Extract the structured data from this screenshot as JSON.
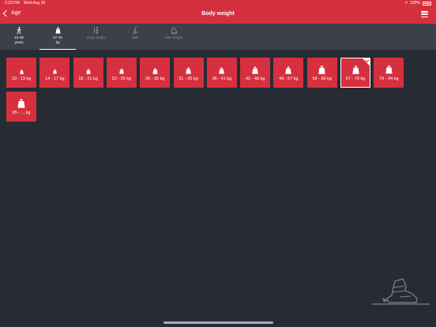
{
  "status": {
    "time": "2:23 PM",
    "date": "Wed Aug 26",
    "battery": "100%"
  },
  "nav": {
    "back_label": "Age",
    "title": "Body weight"
  },
  "tabs": [
    {
      "label": "10-49\nyears",
      "icon": "walking-person-icon",
      "active": false,
      "dim": false
    },
    {
      "label": "67-78\nkg",
      "icon": "weight-icon",
      "active": true,
      "dim": false
    },
    {
      "label": "Body height",
      "icon": "body-height-icon",
      "active": false,
      "dim": true
    },
    {
      "label": "Skill",
      "icon": "skier-icon",
      "active": false,
      "dim": true
    },
    {
      "label": "Sole length",
      "icon": "sole-length-icon",
      "active": false,
      "dim": true
    }
  ],
  "weights": [
    {
      "label": "10 - 13 kg"
    },
    {
      "label": "14 - 17 kg"
    },
    {
      "label": "18 - 21 kg"
    },
    {
      "label": "22 - 25 kg"
    },
    {
      "label": "26 - 30 kg"
    },
    {
      "label": "31 - 35 kg"
    },
    {
      "label": "36 - 41 kg"
    },
    {
      "label": "42 - 48 kg"
    },
    {
      "label": "49 - 57 kg"
    },
    {
      "label": "58 - 66 kg"
    },
    {
      "label": "67 - 78 kg",
      "selected": true
    },
    {
      "label": "79 - 94 kg"
    },
    {
      "label": "95 - ... kg"
    }
  ],
  "colors": {
    "accent": "#d6303f",
    "background": "#272b34",
    "tabbar": "#3b404a"
  }
}
